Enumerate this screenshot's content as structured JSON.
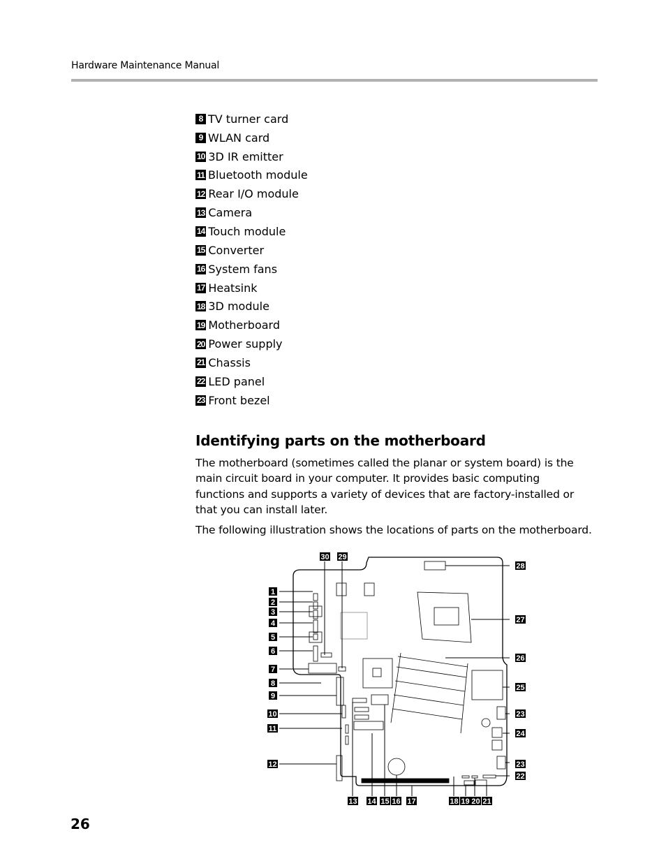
{
  "header": {
    "running_title": "Hardware Maintenance Manual"
  },
  "parts_list": [
    {
      "number": "8",
      "label": "TV turner card"
    },
    {
      "number": "9",
      "label": "WLAN card"
    },
    {
      "number": "10",
      "label": "3D IR emitter"
    },
    {
      "number": "11",
      "label": "Bluetooth module"
    },
    {
      "number": "12",
      "label": "Rear I/O module"
    },
    {
      "number": "13",
      "label": "Camera"
    },
    {
      "number": "14",
      "label": "Touch module"
    },
    {
      "number": "15",
      "label": "Converter"
    },
    {
      "number": "16",
      "label": "System fans"
    },
    {
      "number": "17",
      "label": "Heatsink"
    },
    {
      "number": "18",
      "label": "3D module"
    },
    {
      "number": "19",
      "label": "Motherboard"
    },
    {
      "number": "20",
      "label": "Power supply"
    },
    {
      "number": "21",
      "label": "Chassis"
    },
    {
      "number": "22",
      "label": "LED panel"
    },
    {
      "number": "23",
      "label": "Front bezel"
    }
  ],
  "section": {
    "title": "Identifying parts on the motherboard",
    "paragraph_1": "The motherboard (sometimes called the planar or system board) is the main circuit board in your computer. It provides basic computing functions and supports a variety of devices that are factory-installed or that you can install later.",
    "paragraph_2": "The following illustration shows the locations of parts on the motherboard."
  },
  "figure": {
    "callouts_left": [
      "1",
      "2",
      "3",
      "4",
      "5",
      "6",
      "7",
      "8",
      "9",
      "10",
      "11",
      "12"
    ],
    "callouts_top": [
      "30",
      "29"
    ],
    "callouts_right": [
      "28",
      "27",
      "26",
      "25",
      "23",
      "24",
      "23",
      "22"
    ],
    "callouts_bottom": [
      "13",
      "14",
      "15",
      "16",
      "17",
      "18",
      "19",
      "20",
      "21"
    ]
  },
  "footer": {
    "page_number": "26"
  }
}
